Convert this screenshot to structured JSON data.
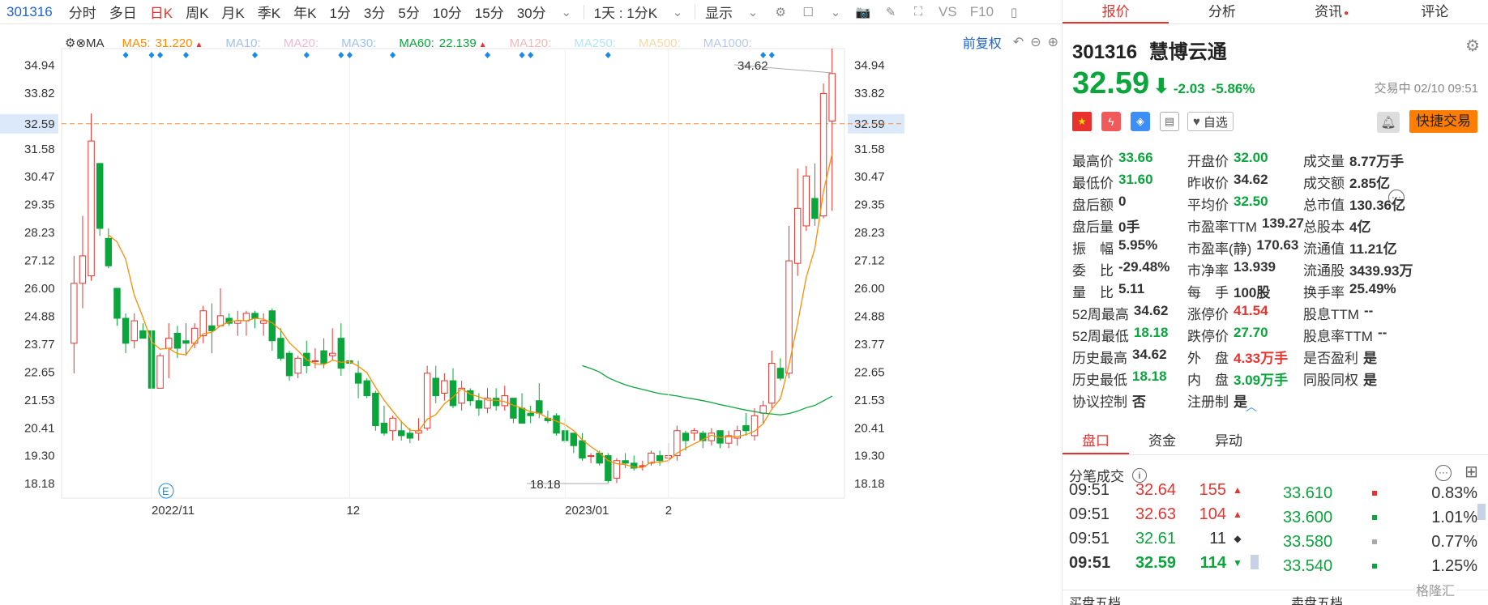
{
  "toolbar": {
    "code": "301316",
    "items": [
      "分时",
      "多日",
      "日K",
      "周K",
      "月K",
      "季K",
      "年K",
      "1分",
      "3分",
      "5分",
      "10分",
      "15分",
      "30分"
    ],
    "active": "日K",
    "period_select": "1天 : 1分K",
    "display": "显示",
    "vs": "VS",
    "f10": "F10"
  },
  "ma_bar": {
    "label": "MA",
    "items": [
      {
        "name": "MA5:",
        "value": "31.220",
        "color": "#ff8c00",
        "arrow": "▲"
      },
      {
        "name": "MA10:",
        "value": "",
        "color": "#9ec2f2"
      },
      {
        "name": "MA20:",
        "value": "",
        "color": "#f5b8d4"
      },
      {
        "name": "MA30:",
        "value": "",
        "color": "#9ec2f2"
      },
      {
        "name": "MA60:",
        "value": "22.139",
        "color": "#0aa63c",
        "arrow": "▲"
      },
      {
        "name": "MA120:",
        "value": "",
        "color": "#f5b8b8"
      },
      {
        "name": "MA250:",
        "value": "",
        "color": "#b4e6f2"
      },
      {
        "name": "MA500:",
        "value": "",
        "color": "#f7d9a8"
      },
      {
        "name": "MA1000:",
        "value": "",
        "color": "#b8c8e8"
      }
    ],
    "adjust": "前复权"
  },
  "chart_data": {
    "type": "candlestick",
    "y_ticks": [
      "34.94",
      "33.82",
      "32.59",
      "31.58",
      "30.47",
      "29.35",
      "28.23",
      "27.12",
      "26.00",
      "24.88",
      "23.77",
      "22.65",
      "21.53",
      "20.41",
      "19.30",
      "18.18"
    ],
    "y_range": [
      17.6,
      35.6
    ],
    "current_price": 32.59,
    "x_ticks": [
      "2022/11",
      "12",
      "2023/01",
      "2"
    ],
    "x_tick_index": [
      10,
      33,
      58,
      70
    ],
    "high_marker": "34.62",
    "low_marker": "18.18",
    "candles": [
      [
        23.8,
        26.2,
        22.6,
        27.3
      ],
      [
        26.2,
        27.3,
        25.2,
        28.9
      ],
      [
        26.5,
        31.9,
        26.3,
        33.0
      ],
      [
        31.0,
        28.4,
        28.1,
        31.0
      ],
      [
        28.0,
        26.9,
        26.8,
        28.4
      ],
      [
        26.0,
        24.8,
        24.5,
        26.0
      ],
      [
        24.8,
        23.8,
        23.4,
        25.0
      ],
      [
        23.9,
        24.7,
        23.6,
        25.0
      ],
      [
        24.3,
        24.0,
        24.0,
        24.6
      ],
      [
        24.3,
        22.0,
        21.9,
        24.5
      ],
      [
        22.0,
        23.3,
        22.0,
        23.4
      ],
      [
        23.6,
        24.0,
        22.4,
        24.6
      ],
      [
        24.2,
        23.6,
        23.2,
        24.5
      ],
      [
        23.9,
        23.8,
        23.3,
        24.6
      ],
      [
        23.8,
        24.4,
        23.6,
        24.6
      ],
      [
        24.1,
        25.1,
        23.8,
        25.3
      ],
      [
        24.5,
        24.3,
        23.4,
        25.4
      ],
      [
        24.5,
        24.9,
        24.5,
        26.0
      ],
      [
        24.8,
        24.6,
        24.5,
        25.0
      ],
      [
        24.6,
        24.7,
        24.1,
        25.1
      ],
      [
        24.7,
        25.0,
        24.1,
        25.1
      ],
      [
        25.0,
        24.8,
        24.4,
        25.1
      ],
      [
        24.6,
        24.7,
        24.1,
        25.0
      ],
      [
        25.1,
        23.9,
        23.5,
        25.2
      ],
      [
        24.0,
        23.2,
        23.1,
        24.4
      ],
      [
        23.4,
        22.5,
        22.3,
        23.5
      ],
      [
        22.6,
        23.2,
        22.4,
        23.3
      ],
      [
        23.4,
        22.9,
        22.6,
        23.9
      ],
      [
        23.1,
        23.1,
        22.8,
        23.6
      ],
      [
        23.5,
        23.0,
        22.8,
        24.0
      ],
      [
        23.3,
        23.4,
        23.1,
        24.4
      ],
      [
        24.0,
        22.8,
        22.5,
        24.6
      ],
      [
        23.1,
        23.0,
        22.6,
        23.4
      ],
      [
        22.6,
        22.2,
        21.6,
        23.1
      ],
      [
        22.3,
        21.7,
        21.6,
        22.4
      ],
      [
        21.8,
        20.5,
        20.3,
        21.9
      ],
      [
        20.6,
        20.2,
        20.1,
        21.3
      ],
      [
        20.3,
        20.8,
        19.9,
        20.9
      ],
      [
        20.3,
        20.1,
        19.9,
        20.7
      ],
      [
        20.2,
        20.0,
        19.8,
        20.4
      ],
      [
        20.2,
        20.3,
        19.9,
        20.8
      ],
      [
        20.4,
        22.6,
        20.3,
        22.9
      ],
      [
        22.4,
        21.7,
        21.4,
        22.9
      ],
      [
        21.8,
        22.3,
        21.5,
        22.6
      ],
      [
        22.3,
        21.3,
        21.2,
        22.8
      ],
      [
        21.4,
        22.0,
        21.1,
        22.3
      ],
      [
        21.9,
        21.5,
        21.3,
        22.0
      ],
      [
        21.5,
        21.2,
        20.9,
        21.8
      ],
      [
        21.2,
        21.6,
        21.0,
        22.0
      ],
      [
        21.6,
        21.3,
        21.1,
        22.0
      ],
      [
        21.3,
        21.7,
        21.1,
        22.1
      ],
      [
        21.6,
        20.8,
        20.6,
        21.6
      ],
      [
        21.2,
        20.6,
        20.6,
        21.8
      ],
      [
        21.0,
        20.9,
        20.6,
        21.3
      ],
      [
        21.5,
        21.0,
        20.8,
        22.2
      ],
      [
        20.8,
        20.7,
        20.6,
        21.1
      ],
      [
        20.9,
        20.2,
        20.1,
        21.0
      ],
      [
        20.3,
        19.9,
        19.8,
        20.8
      ],
      [
        20.2,
        19.7,
        19.4,
        20.2
      ],
      [
        19.9,
        19.2,
        19.1,
        20.2
      ],
      [
        19.3,
        19.3,
        19.0,
        19.4
      ],
      [
        19.4,
        19.0,
        18.9,
        19.5
      ],
      [
        19.3,
        18.3,
        18.2,
        19.4
      ],
      [
        18.4,
        19.1,
        18.2,
        19.2
      ],
      [
        19.1,
        19.0,
        18.8,
        19.4
      ],
      [
        19.0,
        18.8,
        18.7,
        19.3
      ],
      [
        18.9,
        18.9,
        18.7,
        19.1
      ]
    ]
  },
  "quote": {
    "code": "301316",
    "name": "慧博云通",
    "price": "32.59",
    "change": "-2.03",
    "change_pct": "-5.86%",
    "status": "交易中 02/10 09:51",
    "watch": "自选",
    "quick_trade": "快捷交易"
  },
  "stats": [
    [
      {
        "l": "最高价",
        "v": "33.66",
        "c": "green"
      },
      {
        "l": "开盘价",
        "v": "32.00",
        "c": "green"
      },
      {
        "l": "成交量",
        "v": "8.77万手",
        "c": ""
      }
    ],
    [
      {
        "l": "最低价",
        "v": "31.60",
        "c": "green"
      },
      {
        "l": "昨收价",
        "v": "34.62",
        "c": ""
      },
      {
        "l": "成交额",
        "v": "2.85亿",
        "c": ""
      }
    ],
    [
      {
        "l": "盘后额",
        "v": "0",
        "c": ""
      },
      {
        "l": "平均价",
        "v": "32.50",
        "c": "green"
      },
      {
        "l": "总市值",
        "v": "130.36亿",
        "c": ""
      }
    ],
    [
      {
        "l": "盘后量",
        "v": "0手",
        "c": ""
      },
      {
        "l": "市盈率TTM",
        "v": "139.27",
        "c": ""
      },
      {
        "l": "总股本",
        "v": "4亿",
        "c": ""
      }
    ],
    [
      {
        "l": "振　幅",
        "v": "5.95%",
        "c": ""
      },
      {
        "l": "市盈率(静)",
        "v": "170.63",
        "c": ""
      },
      {
        "l": "流通值",
        "v": "11.21亿",
        "c": ""
      }
    ],
    [
      {
        "l": "委　比",
        "v": "-29.48%",
        "c": ""
      },
      {
        "l": "市净率",
        "v": "13.939",
        "c": ""
      },
      {
        "l": "流通股",
        "v": "3439.93万",
        "c": ""
      }
    ],
    [
      {
        "l": "量　比",
        "v": "5.11",
        "c": ""
      },
      {
        "l": "每　手",
        "v": "100股",
        "c": ""
      },
      {
        "l": "换手率",
        "v": "25.49%",
        "c": ""
      }
    ],
    [
      {
        "l": "52周最高",
        "v": "34.62",
        "c": ""
      },
      {
        "l": "涨停价",
        "v": "41.54",
        "c": "red"
      },
      {
        "l": "股息TTM",
        "v": "--",
        "c": ""
      }
    ],
    [
      {
        "l": "52周最低",
        "v": "18.18",
        "c": "green"
      },
      {
        "l": "跌停价",
        "v": "27.70",
        "c": "green"
      },
      {
        "l": "股息率TTM",
        "v": "--",
        "c": ""
      }
    ],
    [
      {
        "l": "历史最高",
        "v": "34.62",
        "c": ""
      },
      {
        "l": "外　盘",
        "v": "4.33万手",
        "c": "red"
      },
      {
        "l": "是否盈利",
        "v": "是",
        "c": ""
      }
    ],
    [
      {
        "l": "历史最低",
        "v": "18.18",
        "c": "green"
      },
      {
        "l": "内　盘",
        "v": "3.09万手",
        "c": "green"
      },
      {
        "l": "同股同权",
        "v": "是",
        "c": ""
      }
    ],
    [
      {
        "l": "协议控制",
        "v": "否",
        "c": ""
      },
      {
        "l": "注册制",
        "v": "是",
        "c": ""
      },
      {
        "l": "",
        "v": "",
        "c": ""
      }
    ]
  ],
  "subtabs": [
    "盘口",
    "资金",
    "异动"
  ],
  "ticks_title": "分笔成交",
  "ticks": [
    {
      "t": "09:51",
      "p": "32.64",
      "v": "155",
      "c": "red",
      "m": "▲"
    },
    {
      "t": "09:51",
      "p": "32.63",
      "v": "104",
      "c": "red",
      "m": "▲"
    },
    {
      "t": "09:51",
      "p": "32.61",
      "v": "11",
      "c": "",
      "m": "◆"
    },
    {
      "t": "09:51",
      "p": "32.59",
      "v": "114",
      "c": "green",
      "m": "▼"
    }
  ],
  "depth": [
    {
      "p": "33.610",
      "pct": "0.83%",
      "bar": "#e8322d"
    },
    {
      "p": "33.600",
      "pct": "1.01%",
      "bar": "#0aa63c"
    },
    {
      "p": "33.580",
      "pct": "0.77%",
      "bar": "#aaaaaa"
    },
    {
      "p": "33.540",
      "pct": "1.25%",
      "bar": "#0aa63c"
    }
  ],
  "bottom_labels": [
    "买盘五档",
    "卖盘五档"
  ],
  "watermark": "格隆汇",
  "colors": {
    "up": "#e8322d",
    "down": "#0aa63c",
    "accent": "#e8322d",
    "link": "#1a63d8"
  }
}
